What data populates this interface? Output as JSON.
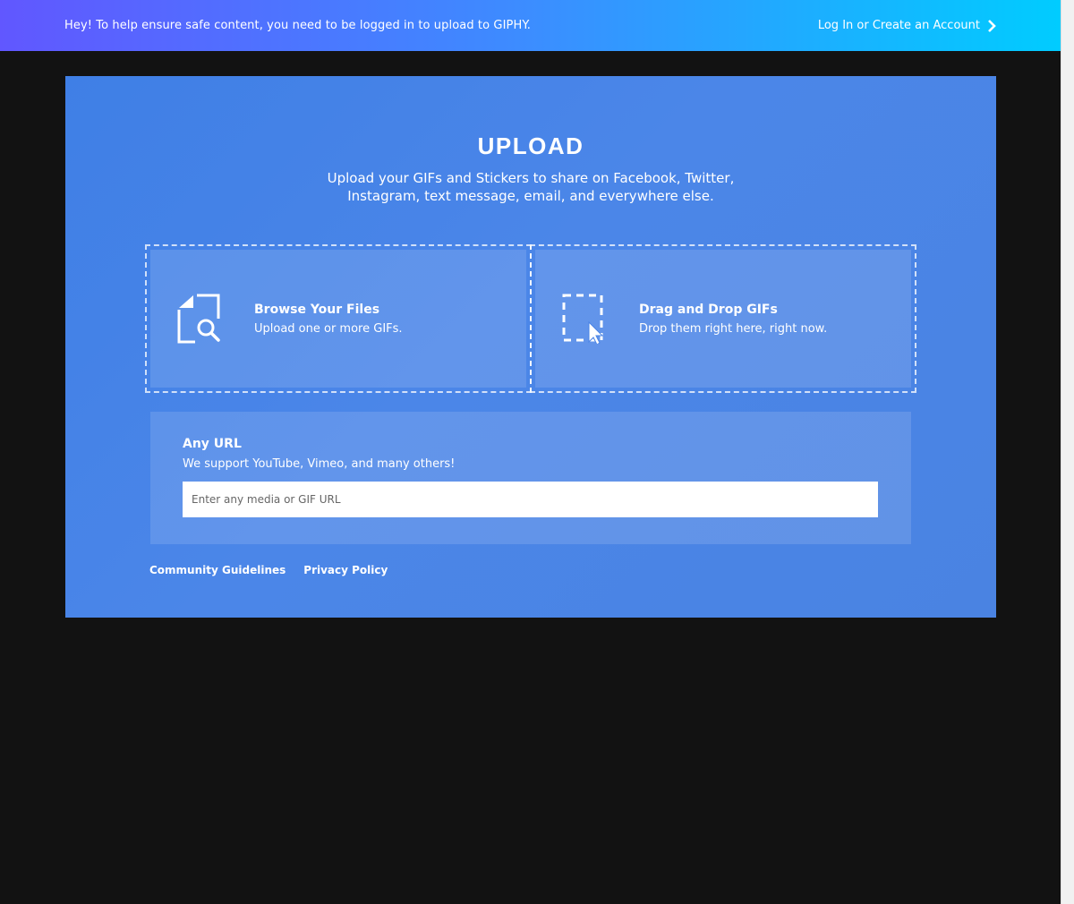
{
  "notice": {
    "text": "Hey! To help ensure safe content, you need to be logged in to upload to GIPHY.",
    "login_link": "Log In or Create an Account",
    "link_icon": "chevron-right-icon"
  },
  "upload": {
    "title": "UPLOAD",
    "subtitle": "Upload your GIFs and Stickers to share on Facebook, Twitter, Instagram, text message, email, and everywhere else.",
    "browse": {
      "icon": "file-search-icon",
      "title": "Browse Your Files",
      "description": "Upload one or more GIFs."
    },
    "drag_drop": {
      "icon": "drag-drop-cursor-icon",
      "title": "Drag and Drop GIFs",
      "description": "Drop them right here, right now."
    },
    "url": {
      "title": "Any URL",
      "description": "We support YouTube, Vimeo, and many others!",
      "value": "",
      "placeholder": "Enter any media or GIF URL"
    }
  },
  "footer": {
    "community_guidelines": "Community Guidelines",
    "privacy_policy": "Privacy Policy"
  },
  "colors": {
    "background": "#121212",
    "panel": "#4a84e6",
    "gradient_start": "#6157ff",
    "gradient_end": "#00ccff"
  }
}
